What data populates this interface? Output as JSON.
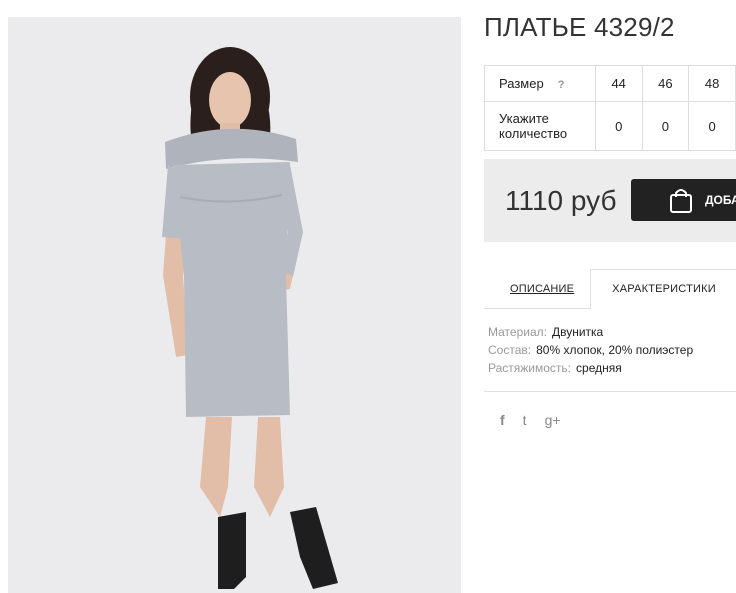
{
  "product": {
    "title": "ПЛАТЬЕ 4329/2"
  },
  "sizes_table": {
    "size_label": "Размер",
    "help": "?",
    "sizes": [
      "44",
      "46",
      "48"
    ],
    "qty_label": "Укажите количество",
    "quantities": [
      "0",
      "0",
      "0"
    ]
  },
  "buy": {
    "price": "1110 руб",
    "add_label": "ДОБА",
    "icon": "shopping-bag-icon"
  },
  "tabs": [
    {
      "label": "ОПИСАНИЕ"
    },
    {
      "label": "ХАРАКТЕРИСТИКИ"
    }
  ],
  "specs": [
    {
      "key": "Материал:",
      "value": "Двунитка"
    },
    {
      "key": "Состав:",
      "value": "80% хлопок, 20% полиэстер"
    },
    {
      "key": "Растяжимость:",
      "value": "средняя"
    }
  ],
  "social": [
    {
      "icon": "facebook-icon",
      "glyph": "f"
    },
    {
      "icon": "twitter-icon",
      "glyph": "t"
    },
    {
      "icon": "google-plus-icon",
      "glyph": "g+"
    }
  ],
  "colors": {
    "dress": "#b8bcc4",
    "button": "#222222",
    "buybox_bg": "#ececec"
  }
}
